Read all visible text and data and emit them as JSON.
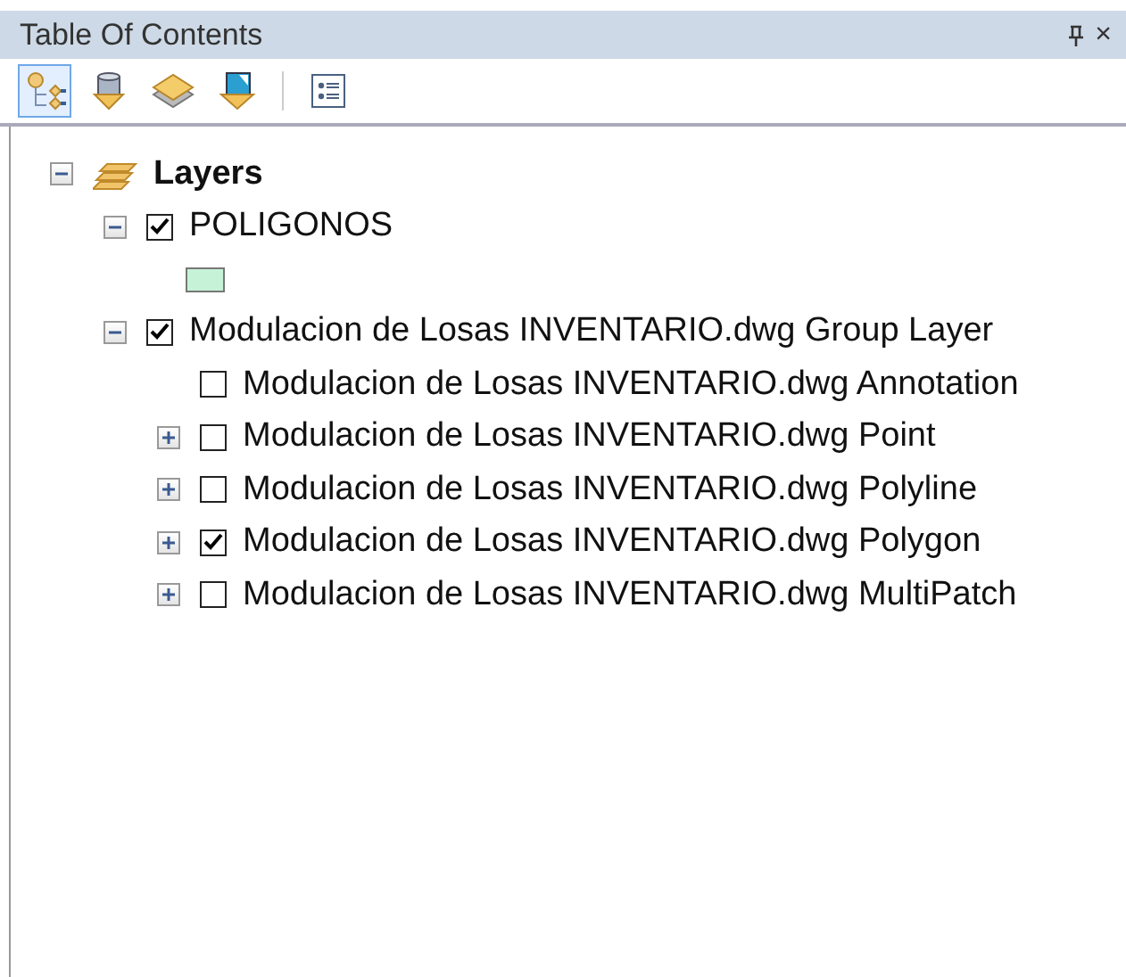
{
  "window": {
    "title": "Table Of Contents",
    "close": "×"
  },
  "toolbar": [
    {
      "kind": "drawing-order",
      "selected": true
    },
    {
      "kind": "source",
      "selected": false
    },
    {
      "kind": "visibility",
      "selected": false
    },
    {
      "kind": "selection",
      "selected": false
    },
    {
      "kind": "options",
      "selected": false
    }
  ],
  "tree": [
    {
      "kind": "root",
      "label": "Layers",
      "expanded": true,
      "children": [
        {
          "kind": "layer",
          "label": "POLIGONOS",
          "expanded": true,
          "checked": true,
          "children": [
            {
              "kind": "legend",
              "color": "#c6f2d8"
            }
          ]
        },
        {
          "kind": "layer",
          "label": "Modulacion de Losas INVENTARIO.dwg Group Layer",
          "expanded": true,
          "checked": true,
          "children": [
            {
              "kind": "layer",
              "label": "Modulacion de Losas INVENTARIO.dwg Annotation",
              "checked": false
            },
            {
              "kind": "layer",
              "label": "Modulacion de Losas INVENTARIO.dwg Point",
              "expanded": false,
              "checked": false
            },
            {
              "kind": "layer",
              "label": "Modulacion de Losas INVENTARIO.dwg Polyline",
              "expanded": false,
              "checked": false
            },
            {
              "kind": "layer",
              "label": "Modulacion de Losas INVENTARIO.dwg Polygon",
              "expanded": false,
              "checked": true
            },
            {
              "kind": "layer",
              "label": "Modulacion de Losas INVENTARIO.dwg MultiPatch",
              "expanded": false,
              "checked": false
            }
          ]
        }
      ]
    }
  ]
}
